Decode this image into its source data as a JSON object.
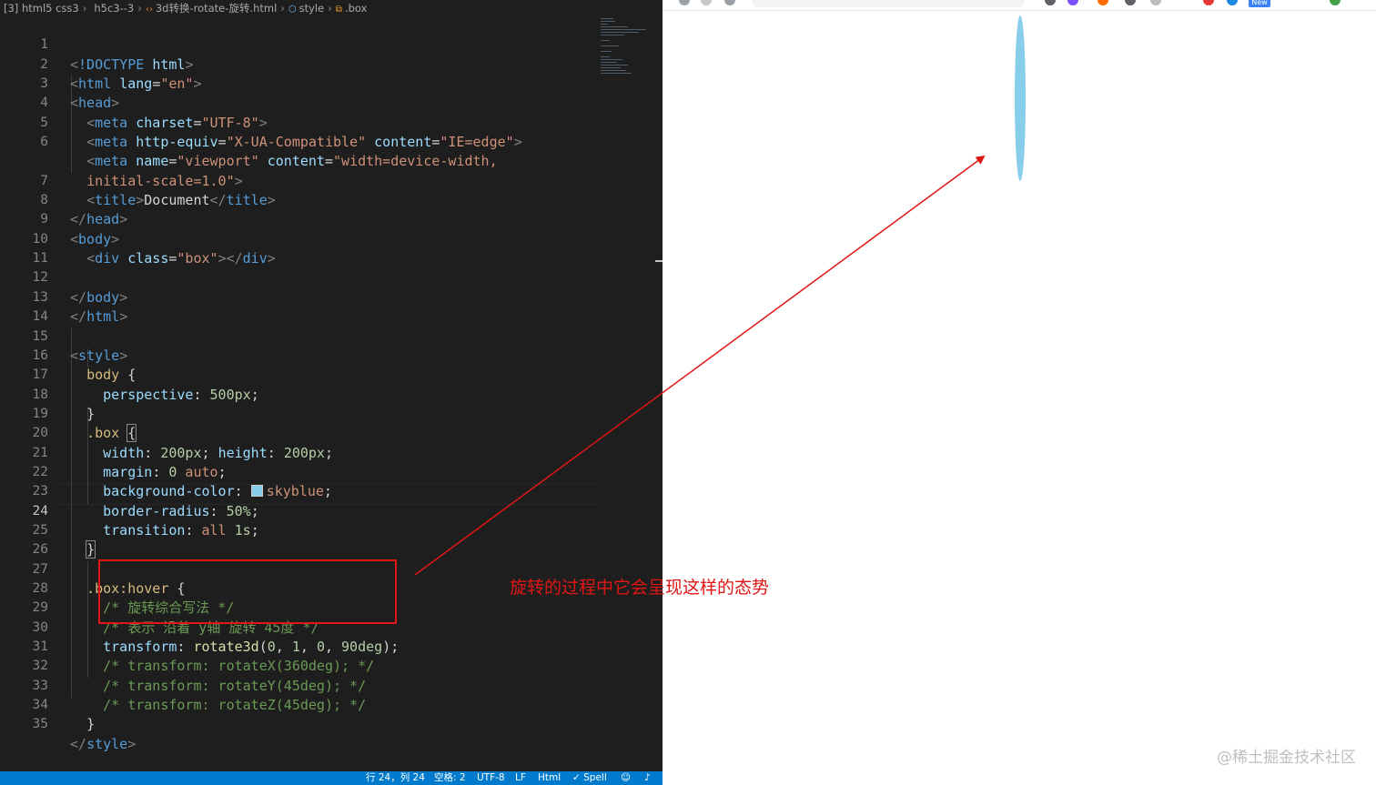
{
  "breadcrumb": {
    "items": [
      "[3] html5 css3",
      "h5c3--3",
      "3d转换-rotate-旋转.html",
      "style",
      ".box"
    ]
  },
  "code_lines": [
    {
      "n": "1"
    },
    {
      "n": "2"
    },
    {
      "n": "3"
    },
    {
      "n": "4"
    },
    {
      "n": "5"
    },
    {
      "n": "6"
    },
    {
      "n": ""
    },
    {
      "n": "7"
    },
    {
      "n": "8"
    },
    {
      "n": "9"
    },
    {
      "n": "10"
    },
    {
      "n": "11"
    },
    {
      "n": "12"
    },
    {
      "n": "13"
    },
    {
      "n": "14"
    },
    {
      "n": "15"
    },
    {
      "n": "16"
    },
    {
      "n": "17"
    },
    {
      "n": "18"
    },
    {
      "n": "19"
    },
    {
      "n": "20"
    },
    {
      "n": "21"
    },
    {
      "n": "22"
    },
    {
      "n": "23"
    },
    {
      "n": "24"
    },
    {
      "n": "25"
    },
    {
      "n": "26"
    },
    {
      "n": "27"
    },
    {
      "n": "28"
    },
    {
      "n": "29"
    },
    {
      "n": "30"
    },
    {
      "n": "31"
    },
    {
      "n": "32"
    },
    {
      "n": "33"
    },
    {
      "n": "34"
    },
    {
      "n": "35"
    }
  ],
  "code": {
    "l1": {
      "lt": "<",
      "text": "!DOCTYPE",
      "kw": "html",
      "gt": ">"
    },
    "l2": {
      "lt": "<",
      "tag": "html",
      "attr": "lang",
      "eq": "=",
      "val": "\"en\"",
      "gt": ">"
    },
    "l3": {
      "lt": "<",
      "tag": "head",
      "gt": ">"
    },
    "l4": {
      "lt": "<",
      "tag": "meta",
      "attr": "charset",
      "eq": "=",
      "val": "\"UTF-8\"",
      "gt": ">"
    },
    "l5": {
      "lt": "<",
      "tag": "meta",
      "attr1": "http-equiv",
      "eq": "=",
      "val1": "\"X-UA-Compatible\"",
      "attr2": "content",
      "val2": "\"IE=edge\"",
      "gt": ">"
    },
    "l6": {
      "lt": "<",
      "tag": "meta",
      "attr1": "name",
      "eq": "=",
      "val1": "\"viewport\"",
      "attr2": "content",
      "val2": "\"width=device-width,"
    },
    "l6b": {
      "val": "initial-scale=1.0\"",
      "gt": ">"
    },
    "l7": {
      "lt": "<",
      "tag": "title",
      "gt": ">",
      "text": "Document",
      "lt2": "</",
      "tag2": "title"
    },
    "l8": {
      "lt": "</",
      "tag": "head",
      "gt": ">"
    },
    "l9": {
      "lt": "<",
      "tag": "body",
      "gt": ">"
    },
    "l10": {
      "lt": "<",
      "tag": "div",
      "attr": "class",
      "eq": "=",
      "val": "\"box\"",
      "gt": ">",
      "lt2": "</",
      "tag2": "div"
    },
    "l12": {
      "lt": "</",
      "tag": "body",
      "gt": ">"
    },
    "l13": {
      "lt": "</",
      "tag": "html",
      "gt": ">"
    },
    "l15": {
      "lt": "<",
      "tag": "style",
      "gt": ">"
    },
    "l16": {
      "sel": "body",
      "brace": " {"
    },
    "l17": {
      "prop": "perspective",
      "colon": ": ",
      "num": "500px",
      "semi": ";"
    },
    "l18": {
      "brace": "}"
    },
    "l19": {
      "sel": ".box",
      "space": " ",
      "brace": "{"
    },
    "l20": {
      "prop1": "width",
      "colon": ": ",
      "num1": "200px",
      "semi1": "; ",
      "prop2": "height",
      "num2": "200px",
      "semi2": ";"
    },
    "l21": {
      "prop": "margin",
      "colon": ": ",
      "num": "0",
      "val": " auto",
      "semi": ";"
    },
    "l22": {
      "prop": "background-color",
      "colon": ": ",
      "val": "skyblue",
      "semi": ";"
    },
    "l23": {
      "prop": "border-radius",
      "colon": ": ",
      "num": "50%",
      "semi": ";"
    },
    "l24": {
      "prop": "transition",
      "colon": ": ",
      "val": "all",
      "num": " 1s",
      "semi": ";"
    },
    "l25": {
      "brace": "}"
    },
    "l27": {
      "sel": ".box:hover",
      "brace": " {"
    },
    "l28": {
      "comment": "/* 旋转综合写法 */"
    },
    "l29": {
      "comment": "/* 表示 沿着 y轴 旋转 45度 */"
    },
    "l30": {
      "prop": "transform",
      "colon": ": ",
      "fn": "rotate3d",
      "open": "(",
      "a1": "0",
      "c1": ", ",
      "a2": "1",
      "c2": ", ",
      "a3": "0",
      "c3": ", ",
      "a4": "90deg",
      "close": ")",
      "semi": ";"
    },
    "l31": {
      "comment": "/* transform: rotateX(360deg); */"
    },
    "l32": {
      "comment": "/* transform: rotateY(45deg); */"
    },
    "l33": {
      "comment": "/* transform: rotateZ(45deg); */"
    },
    "l34": {
      "brace": "}"
    },
    "l35": {
      "lt": "</",
      "tag": "style",
      "gt": ">"
    }
  },
  "statusbar": {
    "position": "行 24，列 24",
    "spaces": "空格: 2",
    "encoding": "UTF-8",
    "eol": "LF",
    "language": "Html",
    "spell": "✓ Spell"
  },
  "browser": {
    "new_badge": "New",
    "ellipse_color": "#87ceeb"
  },
  "annotation": {
    "text": "旋转的过程中它会呈现这样的态势",
    "color": "#e01616"
  },
  "watermark": "@稀土掘金技术社区"
}
